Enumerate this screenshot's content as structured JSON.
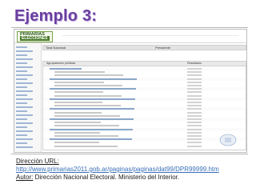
{
  "slide": {
    "title": "Ejemplo 3:",
    "caption_label": "Dirección URL:",
    "caption_url": "http://www.primarias2011.gob.ar/paginas/paginas/dat99/DPR99999.htm",
    "author_label": "Autor:",
    "author_text": " Dirección Nacional Electoral. Ministerio del Interior."
  },
  "screenshot": {
    "logo_line1": "PRIMARIAS",
    "logo_line2": "ELECCIONES",
    "header_left": "Total Nacional",
    "header_center": "Presidente",
    "table_left": "Agrupaciones políticas",
    "table_right": "Resultados"
  },
  "colors": {
    "title": "#6a3ea1",
    "link": "#3a6fb8",
    "accent": "#7aa24a"
  }
}
